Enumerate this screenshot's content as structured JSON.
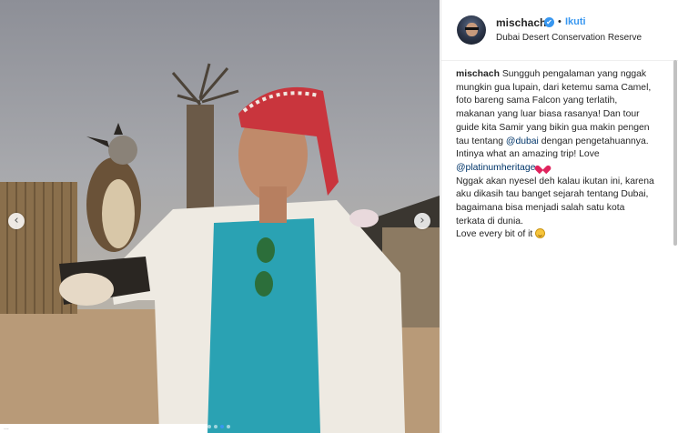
{
  "post": {
    "username": "mischach",
    "follow_label": "Ikuti",
    "bullet": "•",
    "location": "Dubai Desert Conservation Reserve",
    "verified_glyph": "✔",
    "photo_caption_text": "..."
  },
  "caption": {
    "author": "mischach",
    "p1": " Sungguh pengalaman yang nggak mungkin gua lupain, dari ketemu sama Camel, foto bareng sama Falcon yang terlatih, makanan yang luar biasa rasanya! Dan tour guide kita Samir yang bikin gua makin pengen tau tentang ",
    "mention_dubai": "@dubai",
    "p2": " dengan pengetahuannya. Intinya what an amazing trip! Love ",
    "mention_platinum": "@platinumheritage",
    "p3": "Nggak akan nyesel deh kalau ikutan ini, karena aku dikasih tau banget sejarah tentang Dubai, bagaimana bisa menjadi salah satu kota terkata di dunia.",
    "p4": "Love every bit of it "
  },
  "carousel": {
    "prev_glyph": "‹",
    "next_glyph": "›",
    "slide_count": 4,
    "active_slide": 2
  },
  "colors": {
    "accent": "#3897f0",
    "mention": "#003569",
    "heart": "#e0245e"
  }
}
